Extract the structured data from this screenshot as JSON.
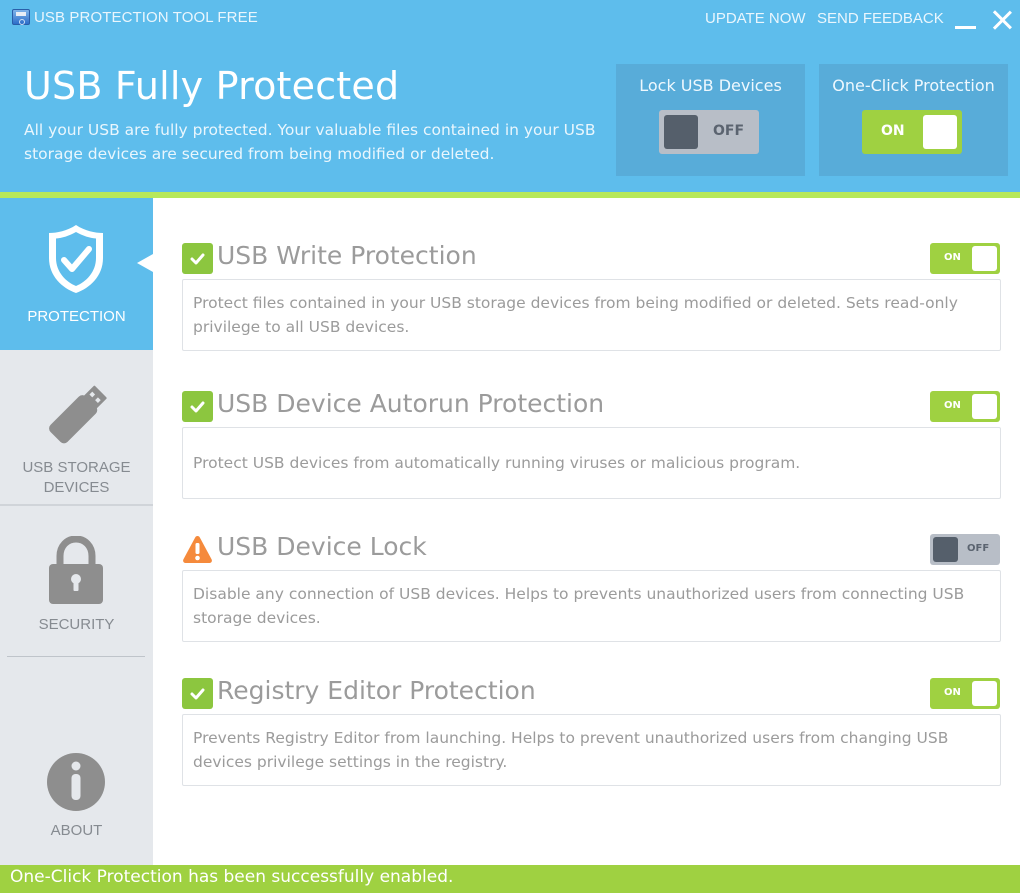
{
  "window": {
    "app_title": "USB PROTECTION TOOL FREE",
    "links": {
      "update": "UPDATE NOW",
      "feedback": "SEND FEEDBACK"
    },
    "controls": [
      "minimize-icon",
      "close-icon"
    ]
  },
  "header": {
    "title": "USB Fully Protected",
    "description": "All your USB are fully protected. Your valuable files contained in your USB storage devices are secured from being modified or deleted.",
    "quick_toggles": [
      {
        "label": "Lock USB Devices",
        "state": "OFF"
      },
      {
        "label": "One-Click Protection",
        "state": "ON"
      }
    ]
  },
  "sidebar": {
    "items": [
      {
        "label": "PROTECTION",
        "icon": "shield-check-icon",
        "active": true
      },
      {
        "label": "USB STORAGE DEVICES",
        "icon": "usb-drive-icon",
        "active": false
      },
      {
        "label": "SECURITY",
        "icon": "padlock-icon",
        "active": false
      },
      {
        "label": "ABOUT",
        "icon": "info-icon",
        "active": false
      }
    ]
  },
  "main": {
    "sections": [
      {
        "title": "USB Write Protection",
        "status_icon": "check-icon",
        "toggle": "ON",
        "description": "Protect files contained in your USB storage devices from being modified or deleted. Sets read-only privilege to all USB devices."
      },
      {
        "title": "USB Device Autorun Protection",
        "status_icon": "check-icon",
        "toggle": "ON",
        "description": "Protect USB devices from automatically running viruses or malicious program."
      },
      {
        "title": "USB Device Lock",
        "status_icon": "warning-icon",
        "toggle": "OFF",
        "description": "Disable any connection of USB devices. Helps to prevents unauthorized users from connecting USB storage devices."
      },
      {
        "title": "Registry Editor Protection",
        "status_icon": "check-icon",
        "toggle": "ON",
        "description": "Prevents Registry Editor from launching. Helps to prevent unauthorized users from changing USB devices privilege settings in the registry."
      }
    ]
  },
  "status_bar": {
    "message": "One-Click Protection has been successfully enabled."
  },
  "colors": {
    "header_blue": "#5ebdec",
    "card_blue": "#58acd9",
    "accent_green": "#9fd141",
    "stripe_green": "#b7e85a",
    "warning_orange": "#f58a3c",
    "toggle_off_gray": "#b8bec7",
    "knob_off_dark": "#555f6b",
    "sidebar_gray": "#e5e8ec",
    "text_gray": "#9b9b9b"
  }
}
